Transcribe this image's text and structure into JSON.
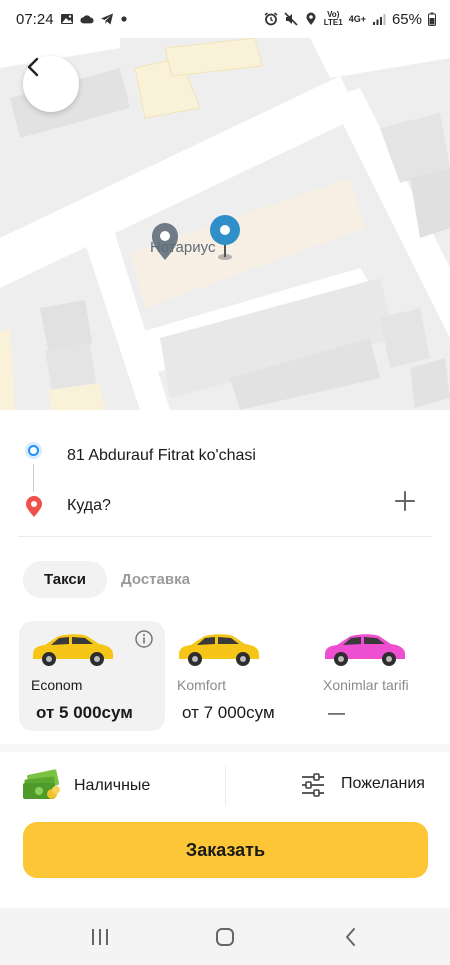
{
  "status_bar": {
    "time": "07:24",
    "network_top": "Vo)",
    "network_bottom": "LTE1",
    "signal_type": "4G+",
    "battery": "65%",
    "icons": [
      "image-icon",
      "cloud-icon",
      "telegram-icon",
      "dot-icon",
      "alarm-icon",
      "mute-icon",
      "location-icon",
      "signal-icon",
      "battery-icon"
    ]
  },
  "map": {
    "poi_label": "Нотариус",
    "back_icon": "chevron-left-icon",
    "pin_icon": "location-pin-icon"
  },
  "route": {
    "from": "81 Abdurauf Fitrat ko'chasi",
    "to_placeholder": "Куда?",
    "add_icon": "plus-icon"
  },
  "service_tabs": {
    "active": "Такси",
    "inactive": "Доставка"
  },
  "tariffs": [
    {
      "name": "Econom",
      "price": "от 5 000сум",
      "car_color": "#f5c518",
      "selected": true
    },
    {
      "name": "Komfort",
      "price": "от 7 000сум",
      "car_color": "#f5c518",
      "selected": false
    },
    {
      "name": "Xonimlar tarifi",
      "price": "—",
      "car_color": "#ee4fd0",
      "selected": false
    }
  ],
  "payment": {
    "method": "Наличные",
    "preferences": "Пожелания"
  },
  "order_button": "Заказать",
  "colors": {
    "accent": "#fcc636",
    "pin_blue": "#2f8fc9",
    "from_dot": "#1e90ff",
    "to_dot": "#f0504a"
  }
}
